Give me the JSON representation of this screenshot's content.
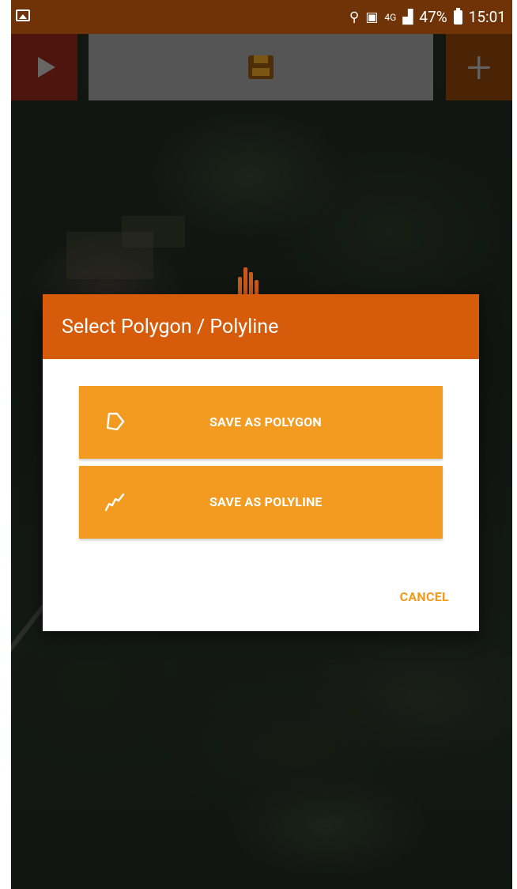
{
  "status_bar": {
    "network_type": "4G",
    "battery_percent": "47%",
    "time": "15:01",
    "icons": [
      "gallery-icon",
      "location-icon",
      "data-saver-icon",
      "signal-icon",
      "battery-icon"
    ]
  },
  "toolbar": {
    "play_icon": "play-icon",
    "save_icon": "save-floppy-icon",
    "add_icon": "plus-icon"
  },
  "dialog": {
    "title": "Select Polygon / Polyline",
    "polygon_button": "SAVE AS POLYGON",
    "polyline_button": "SAVE AS POLYLINE",
    "cancel_button": "CANCEL"
  },
  "colors": {
    "dialog_header": "#d65b0b",
    "option_button": "#f39a21",
    "cancel_text": "#f39a21",
    "status_bar": "#6f3307"
  }
}
